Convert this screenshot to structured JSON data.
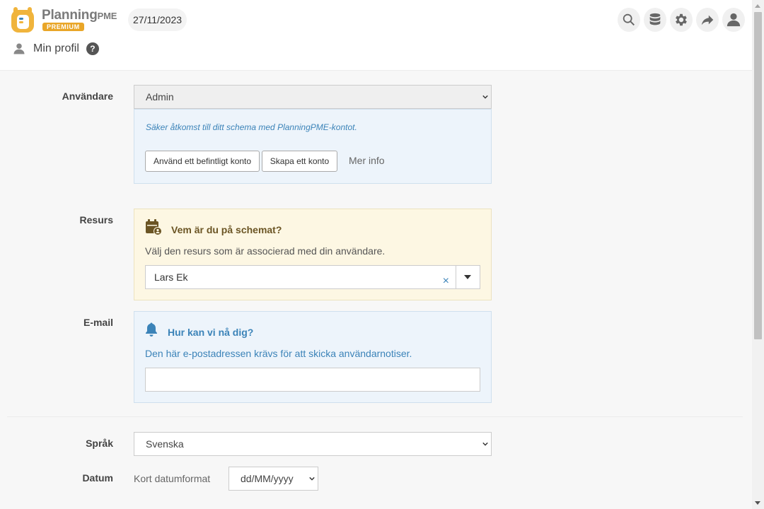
{
  "header": {
    "logo_word": "Planning",
    "logo_word_suffix": "PME",
    "logo_badge": "PREMIUM",
    "date": "27/11/2023",
    "icons": [
      "search-icon",
      "database-icon",
      "gear-icon",
      "share-icon",
      "user-icon"
    ],
    "profile_title": "Min profil",
    "help": "?"
  },
  "form": {
    "user": {
      "label": "Användare",
      "value": "Admin",
      "info": "Säker åtkomst till ditt schema med PlanningPME-kontot.",
      "btn_existing": "Använd ett befintligt konto",
      "btn_create": "Skapa ett konto",
      "more_info": "Mer info"
    },
    "resource": {
      "label": "Resurs",
      "title": "Vem är du på schemat?",
      "desc": "Välj den resurs som är associerad med din användare.",
      "value": "Lars Ek",
      "clear": "×"
    },
    "email": {
      "label": "E-mail",
      "title": "Hur kan vi nå dig?",
      "desc": "Den här e-postadressen krävs för att skicka användarnotiser.",
      "value": ""
    },
    "language": {
      "label": "Språk",
      "value": "Svenska"
    },
    "date": {
      "label": "Datum",
      "sublabel": "Kort datumformat",
      "value": "dd/MM/yyyy"
    }
  },
  "colors": {
    "accent_blue": "#3b83b8",
    "brand_orange": "#e9a628",
    "resource_title": "#6b5524"
  }
}
